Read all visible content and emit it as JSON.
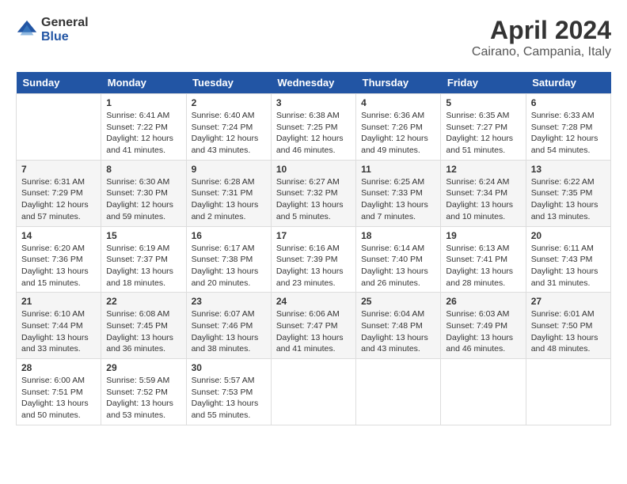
{
  "logo": {
    "general": "General",
    "blue": "Blue"
  },
  "title": "April 2024",
  "location": "Cairano, Campania, Italy",
  "days_of_week": [
    "Sunday",
    "Monday",
    "Tuesday",
    "Wednesday",
    "Thursday",
    "Friday",
    "Saturday"
  ],
  "weeks": [
    [
      {
        "day": "",
        "info": ""
      },
      {
        "day": "1",
        "info": "Sunrise: 6:41 AM\nSunset: 7:22 PM\nDaylight: 12 hours\nand 41 minutes."
      },
      {
        "day": "2",
        "info": "Sunrise: 6:40 AM\nSunset: 7:24 PM\nDaylight: 12 hours\nand 43 minutes."
      },
      {
        "day": "3",
        "info": "Sunrise: 6:38 AM\nSunset: 7:25 PM\nDaylight: 12 hours\nand 46 minutes."
      },
      {
        "day": "4",
        "info": "Sunrise: 6:36 AM\nSunset: 7:26 PM\nDaylight: 12 hours\nand 49 minutes."
      },
      {
        "day": "5",
        "info": "Sunrise: 6:35 AM\nSunset: 7:27 PM\nDaylight: 12 hours\nand 51 minutes."
      },
      {
        "day": "6",
        "info": "Sunrise: 6:33 AM\nSunset: 7:28 PM\nDaylight: 12 hours\nand 54 minutes."
      }
    ],
    [
      {
        "day": "7",
        "info": "Sunrise: 6:31 AM\nSunset: 7:29 PM\nDaylight: 12 hours\nand 57 minutes."
      },
      {
        "day": "8",
        "info": "Sunrise: 6:30 AM\nSunset: 7:30 PM\nDaylight: 12 hours\nand 59 minutes."
      },
      {
        "day": "9",
        "info": "Sunrise: 6:28 AM\nSunset: 7:31 PM\nDaylight: 13 hours\nand 2 minutes."
      },
      {
        "day": "10",
        "info": "Sunrise: 6:27 AM\nSunset: 7:32 PM\nDaylight: 13 hours\nand 5 minutes."
      },
      {
        "day": "11",
        "info": "Sunrise: 6:25 AM\nSunset: 7:33 PM\nDaylight: 13 hours\nand 7 minutes."
      },
      {
        "day": "12",
        "info": "Sunrise: 6:24 AM\nSunset: 7:34 PM\nDaylight: 13 hours\nand 10 minutes."
      },
      {
        "day": "13",
        "info": "Sunrise: 6:22 AM\nSunset: 7:35 PM\nDaylight: 13 hours\nand 13 minutes."
      }
    ],
    [
      {
        "day": "14",
        "info": "Sunrise: 6:20 AM\nSunset: 7:36 PM\nDaylight: 13 hours\nand 15 minutes."
      },
      {
        "day": "15",
        "info": "Sunrise: 6:19 AM\nSunset: 7:37 PM\nDaylight: 13 hours\nand 18 minutes."
      },
      {
        "day": "16",
        "info": "Sunrise: 6:17 AM\nSunset: 7:38 PM\nDaylight: 13 hours\nand 20 minutes."
      },
      {
        "day": "17",
        "info": "Sunrise: 6:16 AM\nSunset: 7:39 PM\nDaylight: 13 hours\nand 23 minutes."
      },
      {
        "day": "18",
        "info": "Sunrise: 6:14 AM\nSunset: 7:40 PM\nDaylight: 13 hours\nand 26 minutes."
      },
      {
        "day": "19",
        "info": "Sunrise: 6:13 AM\nSunset: 7:41 PM\nDaylight: 13 hours\nand 28 minutes."
      },
      {
        "day": "20",
        "info": "Sunrise: 6:11 AM\nSunset: 7:43 PM\nDaylight: 13 hours\nand 31 minutes."
      }
    ],
    [
      {
        "day": "21",
        "info": "Sunrise: 6:10 AM\nSunset: 7:44 PM\nDaylight: 13 hours\nand 33 minutes."
      },
      {
        "day": "22",
        "info": "Sunrise: 6:08 AM\nSunset: 7:45 PM\nDaylight: 13 hours\nand 36 minutes."
      },
      {
        "day": "23",
        "info": "Sunrise: 6:07 AM\nSunset: 7:46 PM\nDaylight: 13 hours\nand 38 minutes."
      },
      {
        "day": "24",
        "info": "Sunrise: 6:06 AM\nSunset: 7:47 PM\nDaylight: 13 hours\nand 41 minutes."
      },
      {
        "day": "25",
        "info": "Sunrise: 6:04 AM\nSunset: 7:48 PM\nDaylight: 13 hours\nand 43 minutes."
      },
      {
        "day": "26",
        "info": "Sunrise: 6:03 AM\nSunset: 7:49 PM\nDaylight: 13 hours\nand 46 minutes."
      },
      {
        "day": "27",
        "info": "Sunrise: 6:01 AM\nSunset: 7:50 PM\nDaylight: 13 hours\nand 48 minutes."
      }
    ],
    [
      {
        "day": "28",
        "info": "Sunrise: 6:00 AM\nSunset: 7:51 PM\nDaylight: 13 hours\nand 50 minutes."
      },
      {
        "day": "29",
        "info": "Sunrise: 5:59 AM\nSunset: 7:52 PM\nDaylight: 13 hours\nand 53 minutes."
      },
      {
        "day": "30",
        "info": "Sunrise: 5:57 AM\nSunset: 7:53 PM\nDaylight: 13 hours\nand 55 minutes."
      },
      {
        "day": "",
        "info": ""
      },
      {
        "day": "",
        "info": ""
      },
      {
        "day": "",
        "info": ""
      },
      {
        "day": "",
        "info": ""
      }
    ]
  ]
}
